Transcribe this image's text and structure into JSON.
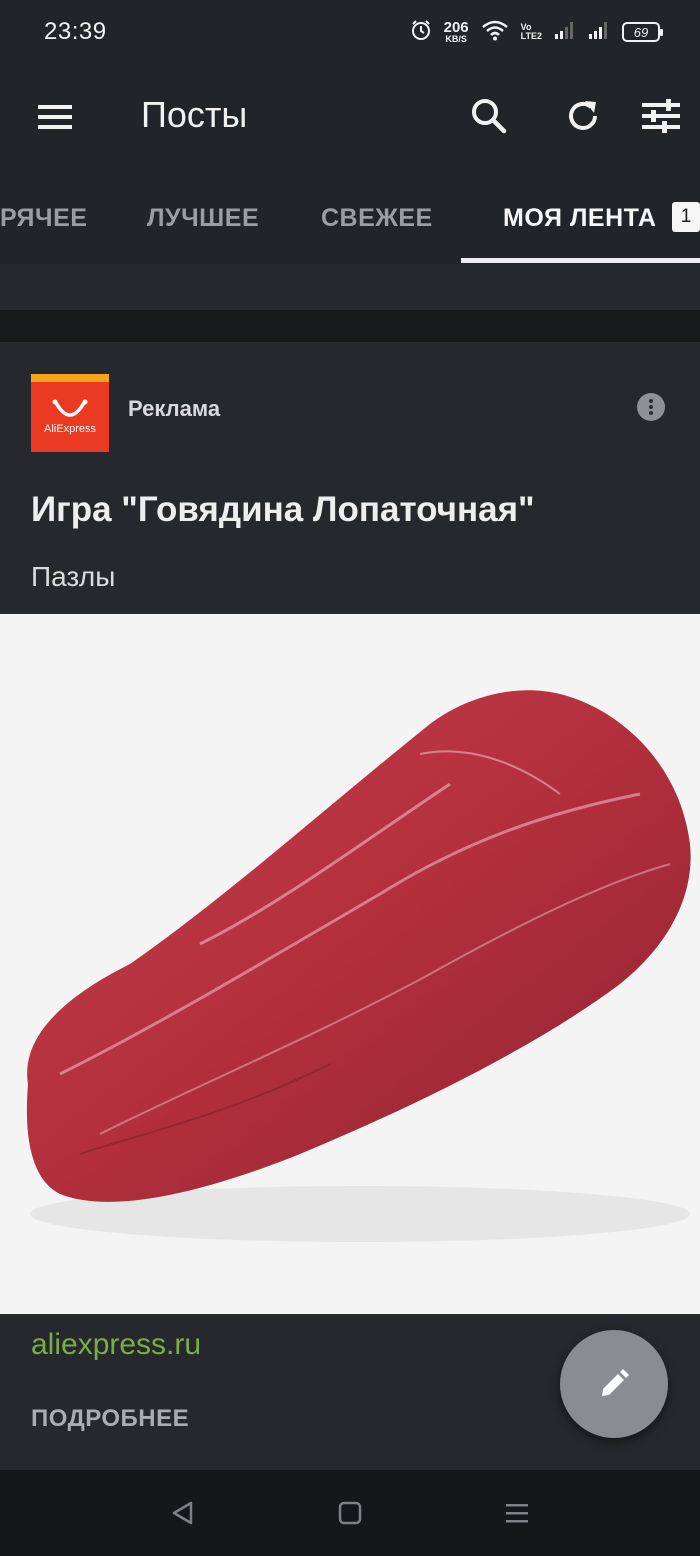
{
  "status_bar": {
    "time": "23:39",
    "net_speed": "206",
    "net_unit": "KB/S",
    "volte_top": "Vo",
    "volte_bottom": "LTE2",
    "battery": "69",
    "icons": [
      "alarm-icon",
      "wifi-icon",
      "signal-icon",
      "signal-icon"
    ]
  },
  "app_bar": {
    "title": "Посты",
    "icons": [
      "menu-icon",
      "search-icon",
      "refresh-icon",
      "filter-icon"
    ]
  },
  "tabs": [
    {
      "label": "РЯЧЕЕ",
      "active": false
    },
    {
      "label": "ЛУЧШЕЕ",
      "active": false
    },
    {
      "label": "СВЕЖЕЕ",
      "active": false
    },
    {
      "label": "МОЯ ЛЕНТА",
      "active": true,
      "badge": "1"
    }
  ],
  "post": {
    "advertiser_logo_text": "AliExpress",
    "label": "Реклама",
    "title": "Игра \"Говядина Лопаточная\"",
    "subtitle": "Пазлы",
    "image_description": "raw beef shoulder cut",
    "link": "aliexpress.ru",
    "more_label": "ПОДРОБНЕЕ"
  },
  "fab": {
    "icon": "pencil-icon"
  },
  "nav_bar": {
    "icons": [
      "back-icon",
      "home-icon",
      "recents-icon"
    ]
  },
  "colors": {
    "background": "#1b1d20",
    "appbar": "#212428",
    "card": "#25282c",
    "link": "#7cad45",
    "logo_red": "#ea3a22",
    "logo_orange": "#f7a21b"
  }
}
